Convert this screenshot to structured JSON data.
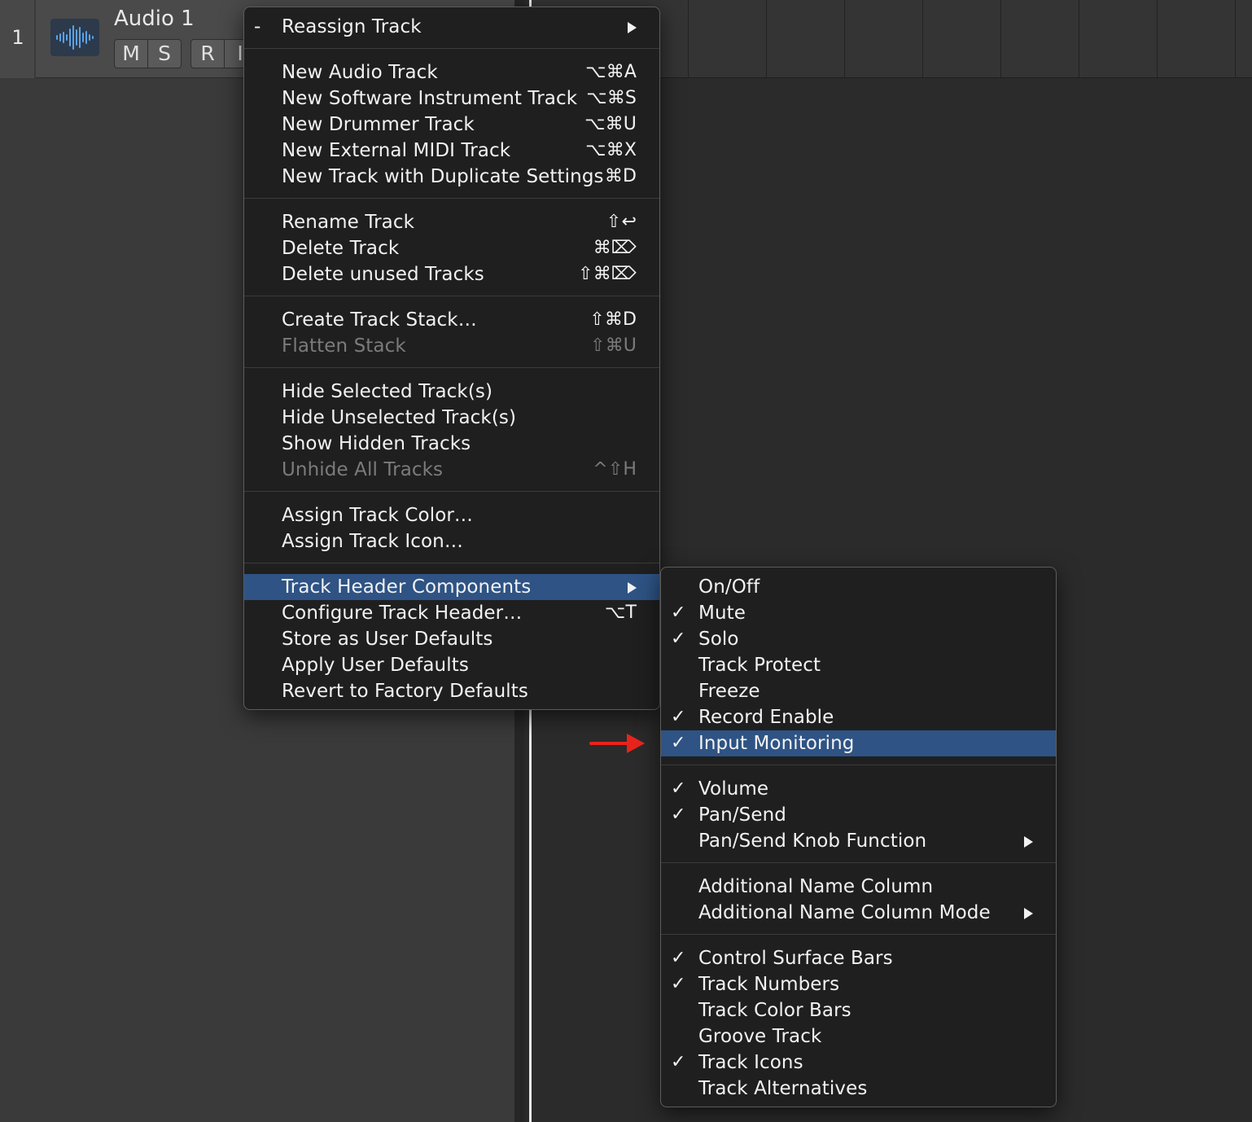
{
  "track": {
    "number": "1",
    "name": "Audio 1",
    "buttons": {
      "mute": "M",
      "solo": "S",
      "record": "R",
      "input": "I"
    }
  },
  "main_menu": {
    "items": [
      {
        "label": "Reassign Track",
        "prefix": "-",
        "submenu": true
      },
      {
        "label": "New Audio Track",
        "shortcut": "⌥⌘A"
      },
      {
        "label": "New Software Instrument Track",
        "shortcut": "⌥⌘S"
      },
      {
        "label": "New Drummer Track",
        "shortcut": "⌥⌘U"
      },
      {
        "label": "New External MIDI Track",
        "shortcut": "⌥⌘X"
      },
      {
        "label": "New Track with Duplicate Settings",
        "shortcut": "⌘D"
      },
      {
        "label": "Rename Track",
        "shortcut": "⇧↩"
      },
      {
        "label": "Delete Track",
        "shortcut": "⌘⌦"
      },
      {
        "label": "Delete unused Tracks",
        "shortcut": "⇧⌘⌦"
      },
      {
        "label": "Create Track Stack…",
        "shortcut": "⇧⌘D"
      },
      {
        "label": "Flatten Stack",
        "shortcut": "⇧⌘U",
        "disabled": true
      },
      {
        "label": "Hide Selected Track(s)"
      },
      {
        "label": "Hide Unselected Track(s)"
      },
      {
        "label": "Show Hidden Tracks"
      },
      {
        "label": "Unhide All Tracks",
        "shortcut": "^⇧H",
        "disabled": true
      },
      {
        "label": "Assign Track Color…"
      },
      {
        "label": "Assign Track Icon…"
      },
      {
        "label": "Track Header Components",
        "submenu": true,
        "highlighted": true
      },
      {
        "label": "Configure Track Header…",
        "shortcut": "⌥T"
      },
      {
        "label": "Store as User Defaults"
      },
      {
        "label": "Apply User Defaults"
      },
      {
        "label": "Revert to Factory Defaults"
      }
    ]
  },
  "sub_menu": {
    "items": [
      {
        "label": "On/Off",
        "checked": false
      },
      {
        "label": "Mute",
        "checked": true
      },
      {
        "label": "Solo",
        "checked": true
      },
      {
        "label": "Track Protect",
        "checked": false
      },
      {
        "label": "Freeze",
        "checked": false
      },
      {
        "label": "Record Enable",
        "checked": true
      },
      {
        "label": "Input Monitoring",
        "checked": true,
        "highlighted": true
      },
      {
        "label": "Volume",
        "checked": true
      },
      {
        "label": "Pan/Send",
        "checked": true
      },
      {
        "label": "Pan/Send Knob Function",
        "checked": false,
        "submenu": true
      },
      {
        "label": "Additional Name Column",
        "checked": false
      },
      {
        "label": "Additional Name Column Mode",
        "checked": false,
        "submenu": true
      },
      {
        "label": "Control Surface Bars",
        "checked": true
      },
      {
        "label": "Track Numbers",
        "checked": true
      },
      {
        "label": "Track Color Bars",
        "checked": false
      },
      {
        "label": "Groove Track",
        "checked": false
      },
      {
        "label": "Track Icons",
        "checked": true
      },
      {
        "label": "Track Alternatives",
        "checked": false
      }
    ]
  },
  "colors": {
    "highlight": "#2e5384",
    "menu_bg": "#1f1f1f",
    "annotation_arrow": "#e8231c"
  },
  "icons": {
    "track_icon": "waveform-icon",
    "submenu_indicator": "triangle-right-icon",
    "check": "checkmark-icon",
    "annotation": "red-arrow-icon"
  }
}
